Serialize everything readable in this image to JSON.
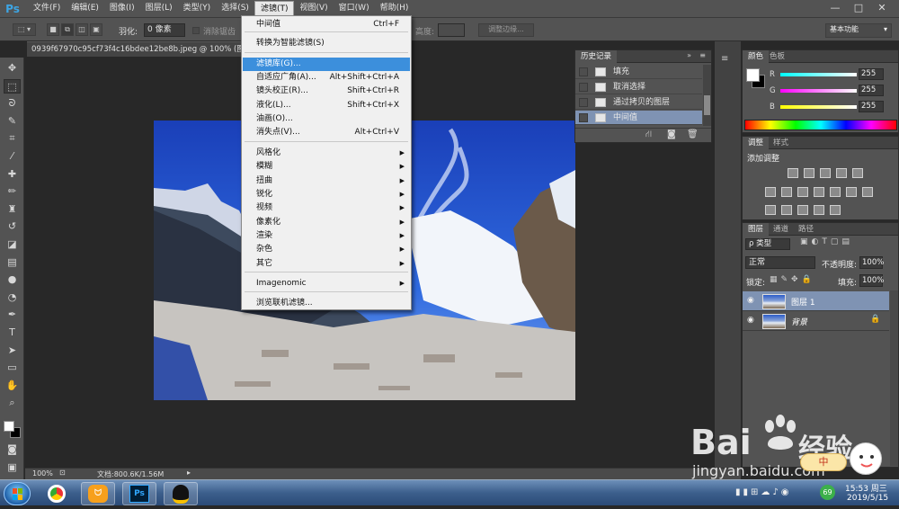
{
  "app": {
    "logo": "Ps"
  },
  "menubar": {
    "items": [
      "文件(F)",
      "编辑(E)",
      "图像(I)",
      "图层(L)",
      "类型(Y)",
      "选择(S)",
      "滤镜(T)",
      "视图(V)",
      "窗口(W)",
      "帮助(H)"
    ],
    "active_index": 6,
    "window_controls": [
      "—",
      "□",
      "✕"
    ]
  },
  "options_bar": {
    "feather_label": "羽化:",
    "feather_value": "0 像素",
    "antialias_label": "消除锯齿",
    "height_label": "高度:",
    "refine_edge": "调整边缘...",
    "workspace": "基本功能"
  },
  "document": {
    "tab_title": "0939f67970c95cf73f4c16bdee12be8b.jpeg @ 100% (图层"
  },
  "status": {
    "zoom": "100%",
    "doc_info": "文档:800.6K/1.56M"
  },
  "filter_menu": {
    "items": [
      {
        "label": "中间值",
        "shortcut": "Ctrl+F"
      },
      {
        "label": "转换为智能滤镜(S)",
        "shortcut": ""
      },
      {
        "label": "滤镜库(G)...",
        "shortcut": ""
      },
      {
        "label": "自适应广角(A)...",
        "shortcut": "Alt+Shift+Ctrl+A"
      },
      {
        "label": "镜头校正(R)...",
        "shortcut": "Shift+Ctrl+R"
      },
      {
        "label": "液化(L)...",
        "shortcut": "Shift+Ctrl+X"
      },
      {
        "label": "油画(O)...",
        "shortcut": ""
      },
      {
        "label": "消失点(V)...",
        "shortcut": "Alt+Ctrl+V"
      },
      {
        "label": "风格化",
        "shortcut": ""
      },
      {
        "label": "模糊",
        "shortcut": ""
      },
      {
        "label": "扭曲",
        "shortcut": ""
      },
      {
        "label": "锐化",
        "shortcut": ""
      },
      {
        "label": "视频",
        "shortcut": ""
      },
      {
        "label": "像素化",
        "shortcut": ""
      },
      {
        "label": "渲染",
        "shortcut": ""
      },
      {
        "label": "杂色",
        "shortcut": ""
      },
      {
        "label": "其它",
        "shortcut": ""
      },
      {
        "label": "Imagenomic",
        "shortcut": ""
      },
      {
        "label": "浏览联机滤镜...",
        "shortcut": ""
      }
    ],
    "highlighted_index": 2
  },
  "history_panel": {
    "tab": "历史记录",
    "items": [
      "填充",
      "取消选择",
      "通过拷贝的图层",
      "中间值"
    ],
    "selected_index": 3
  },
  "color_panel": {
    "tabs": [
      "颜色",
      "色板"
    ],
    "channels": [
      {
        "label": "R",
        "value": "255"
      },
      {
        "label": "G",
        "value": "255"
      },
      {
        "label": "B",
        "value": "255"
      }
    ]
  },
  "adjustments_panel": {
    "tabs": [
      "调整",
      "样式"
    ],
    "title": "添加调整"
  },
  "layers_panel": {
    "tabs": [
      "图层",
      "通道",
      "路径"
    ],
    "filter_kind": "ρ 类型",
    "blend_mode": "正常",
    "opacity_label": "不透明度:",
    "opacity_value": "100%",
    "lock_label": "锁定:",
    "fill_label": "填充:",
    "fill_value": "100%",
    "layers": [
      "图层 1",
      "背景"
    ],
    "selected_index": 0
  },
  "taskbar": {
    "clock_time": "15:53 周三",
    "clock_date": "2019/5/15",
    "badge": "69"
  },
  "watermark": {
    "brand": "Bai",
    "brand2": "经验",
    "url": "jingyan.baidu.com",
    "ime": "中"
  }
}
